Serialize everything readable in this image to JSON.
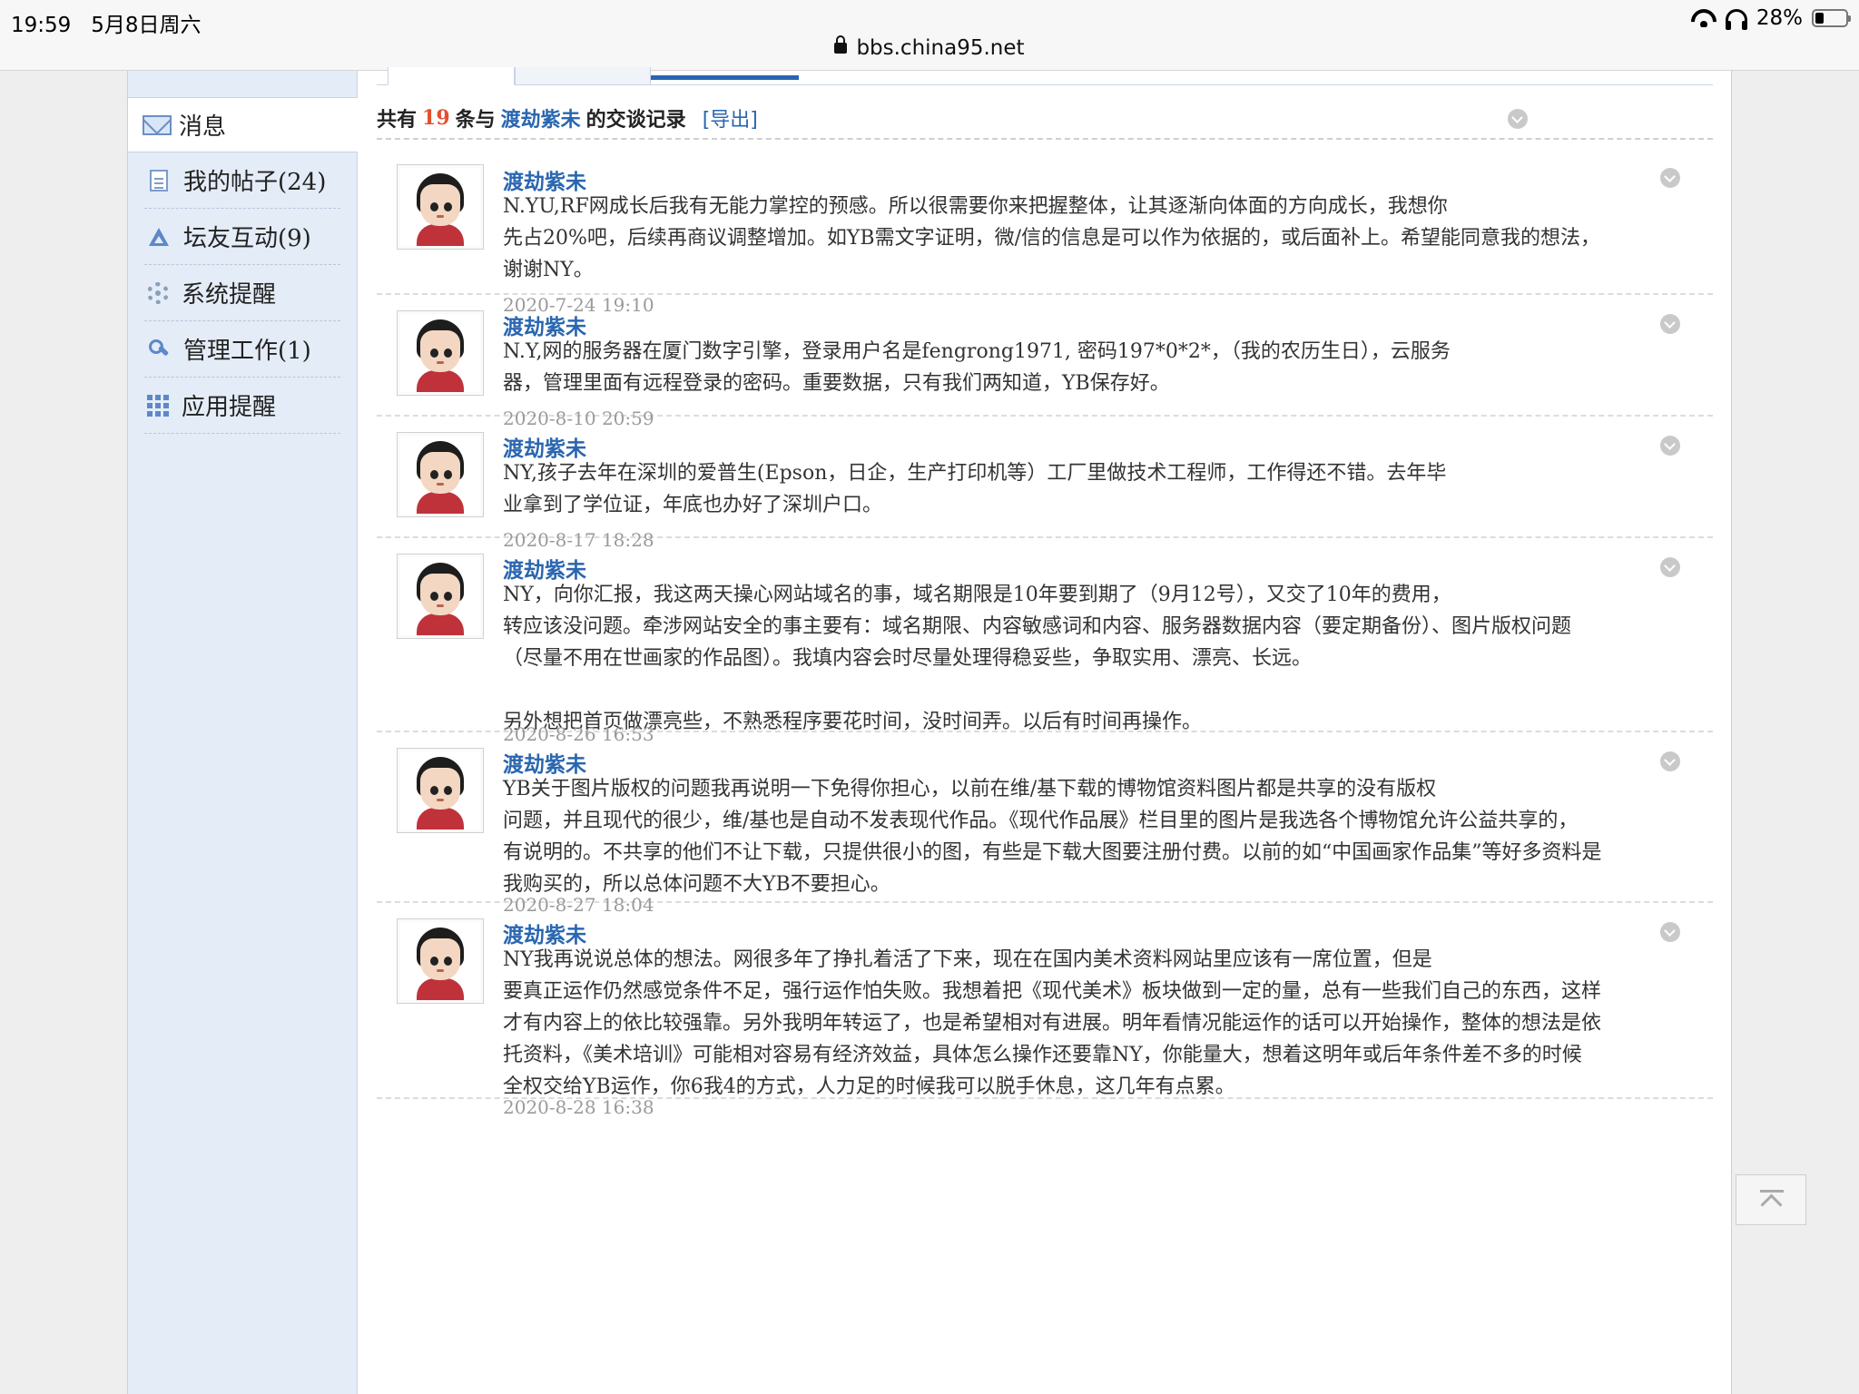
{
  "status_bar": {
    "time": "19:59",
    "date": "5月8日周六",
    "url": "bbs.china95.net",
    "battery": "28%",
    "battery_level": 0.28
  },
  "sidebar": {
    "active": "消息",
    "items": [
      {
        "label": "我的帖子(24)",
        "icon": "document-icon"
      },
      {
        "label": "坛友互动(9)",
        "icon": "recycle-icon"
      },
      {
        "label": "系统提醒",
        "icon": "gear-icon"
      },
      {
        "label": "管理工作(1)",
        "icon": "wrench-icon"
      },
      {
        "label": "应用提醒",
        "icon": "grid-icon"
      }
    ]
  },
  "summary": {
    "prefix": "共有",
    "count": "19",
    "mid": "条与",
    "name": "渡劫紫未",
    "suffix": "的交谈记录",
    "export": "[导出]"
  },
  "messages": [
    {
      "author": "渡劫紫未",
      "text": "N.YU,RF网成长后我有无能力掌控的预感。所以很需要你来把握整体，让其逐渐向体面的方向成长，我想你\n先占20%吧，后续再商议调整增加。如YB需文字证明，微/信的信息是可以作为依据的，或后面补上。希望能同意我的想法，\n谢谢NY。",
      "date": "2020-7-24 19:10"
    },
    {
      "author": "渡劫紫未",
      "text": "N.Y,网的服务器在厦门数字引擎，登录用户名是fengrong1971, 密码197*0*2*，（我的农历生日），云服务\n器，管理里面有远程登录的密码。重要数据，只有我们两知道，YB保存好。",
      "date": "2020-8-10 20:59"
    },
    {
      "author": "渡劫紫未",
      "text": "NY,孩子去年在深圳的爱普生(Epson，日企，生产打印机等）工厂里做技术工程师，工作得还不错。去年毕\n业拿到了学位证，年底也办好了深圳户口。",
      "date": "2020-8-17 18:28"
    },
    {
      "author": "渡劫紫未",
      "text": "NY，向你汇报，我这两天操心网站域名的事，域名期限是10年要到期了（9月12号），又交了10年的费用，\n转应该没问题。牵涉网站安全的事主要有：域名期限、内容敏感词和内容、服务器数据内容（要定期备份）、图片版权问题\n（尽量不用在世画家的作品图）。我填内容会时尽量处理得稳妥些，争取实用、漂亮、长远。\n\n另外想把首页做漂亮些，不熟悉程序要花时间，没时间弄。以后有时间再操作。",
      "date": "2020-8-26 16:53"
    },
    {
      "author": "渡劫紫未",
      "text": "YB关于图片版权的问题我再说明一下免得你担心，以前在维/基下载的博物馆资料图片都是共享的没有版权\n问题，并且现代的很少，维/基也是自动不发表现代作品。《现代作品展》栏目里的图片是我选各个博物馆允许公益共享的，\n有说明的。不共享的他们不让下载，只提供很小的图，有些是下载大图要注册付费。以前的如“中国画家作品集”等好多资料是\n我购买的，所以总体问题不大YB不要担心。",
      "date": "2020-8-27 18:04"
    },
    {
      "author": "渡劫紫未",
      "text": "NY我再说说总体的想法。网很多年了挣扎着活了下来，现在在国内美术资料网站里应该有一席位置，但是\n要真正运作仍然感觉条件不足，强行运作怕失败。我想着把《现代美术》板块做到一定的量，总有一些我们自己的东西，这样\n才有内容上的依比较强靠。另外我明年转运了，也是希望相对有进展。明年看情况能运作的话可以开始操作，整体的想法是依\n托资料，《美术培训》可能相对容易有经济效益，具体怎么操作还要靠NY，你能量大，想着这明年或后年条件差不多的时候\n全权交给YB运作，你6我4的方式，人力足的时候我可以脱手休息，这几年有点累。",
      "date": "2020-8-28 16:38"
    }
  ]
}
